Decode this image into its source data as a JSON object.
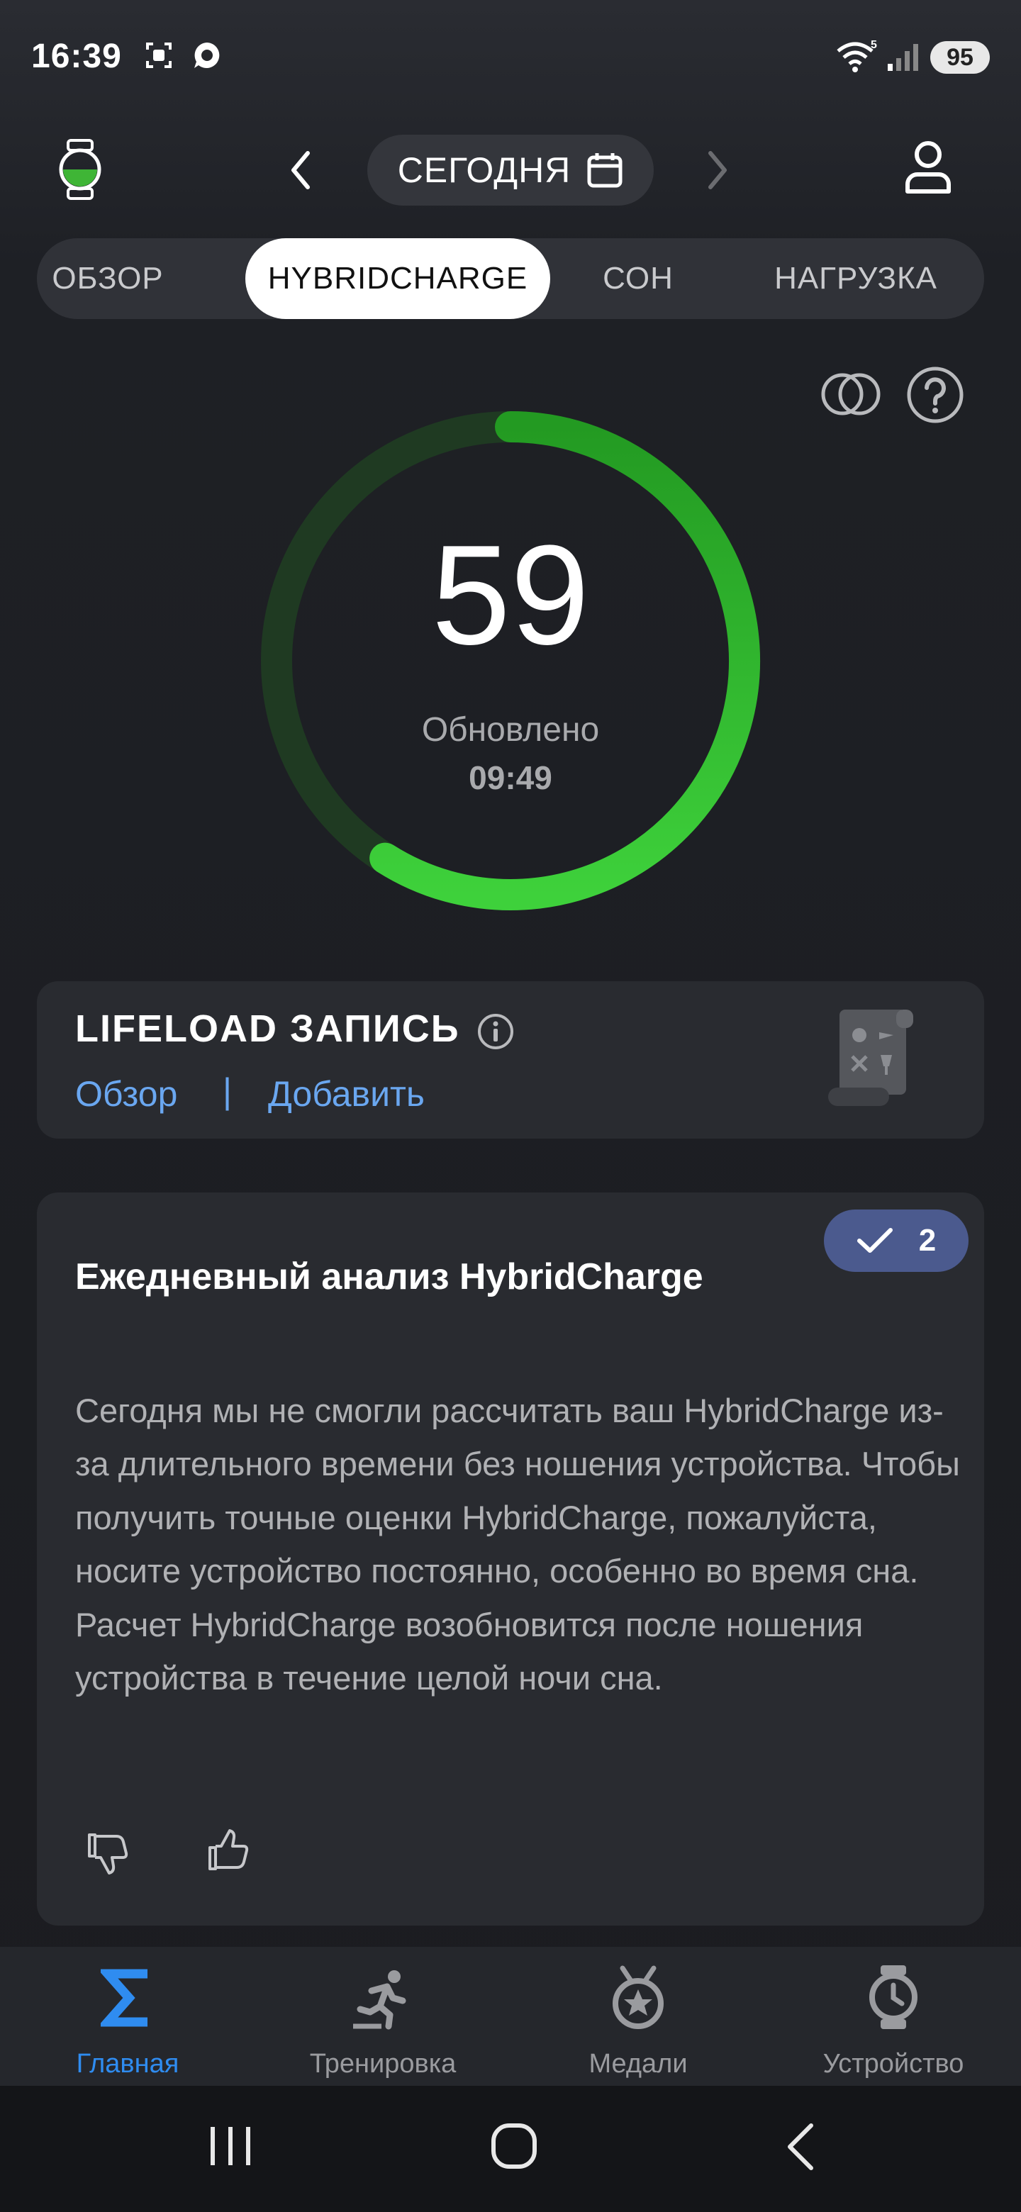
{
  "status_bar": {
    "time": "16:39",
    "battery": "95"
  },
  "header": {
    "date_label": "СЕГОДНЯ"
  },
  "tabs": [
    {
      "label": "ОБЗОР",
      "active": false
    },
    {
      "label": "HYBRIDCHARGE",
      "active": true
    },
    {
      "label": "СОН",
      "active": false
    },
    {
      "label": "НАГРУЗКА",
      "active": false
    }
  ],
  "gauge": {
    "value": "59",
    "progress": 0.59,
    "updated_label": "Обновлено",
    "updated_time": "09:49",
    "accent": "#34c236"
  },
  "lifeload": {
    "title": "LIFELOAD ЗАПИСЬ",
    "link_overview": "Обзор",
    "separator": "|",
    "link_add": "Добавить"
  },
  "analysis": {
    "title": "Ежедневный анализ HybridCharge",
    "badge_count": "2",
    "body": "Сегодня мы не смогли рассчитать ваш HybridCharge из-за длительного времени без ношения устройства. Чтобы получить точные оценки HybridCharge, пожалуйста, носите устройство постоянно, особенно во время сна. Расчет HybridCharge возобновится после ношения устройства в течение целой ночи сна."
  },
  "bottom_nav": [
    {
      "label": "Главная",
      "icon": "sigma-icon",
      "active": true
    },
    {
      "label": "Тренировка",
      "icon": "runner-icon",
      "active": false
    },
    {
      "label": "Медали",
      "icon": "medal-icon",
      "active": false
    },
    {
      "label": "Устройство",
      "icon": "watch-icon",
      "active": false
    }
  ],
  "colors": {
    "accent_blue": "#2f8cf0",
    "link": "#6aa7f0",
    "ring_green": "#34c236"
  }
}
